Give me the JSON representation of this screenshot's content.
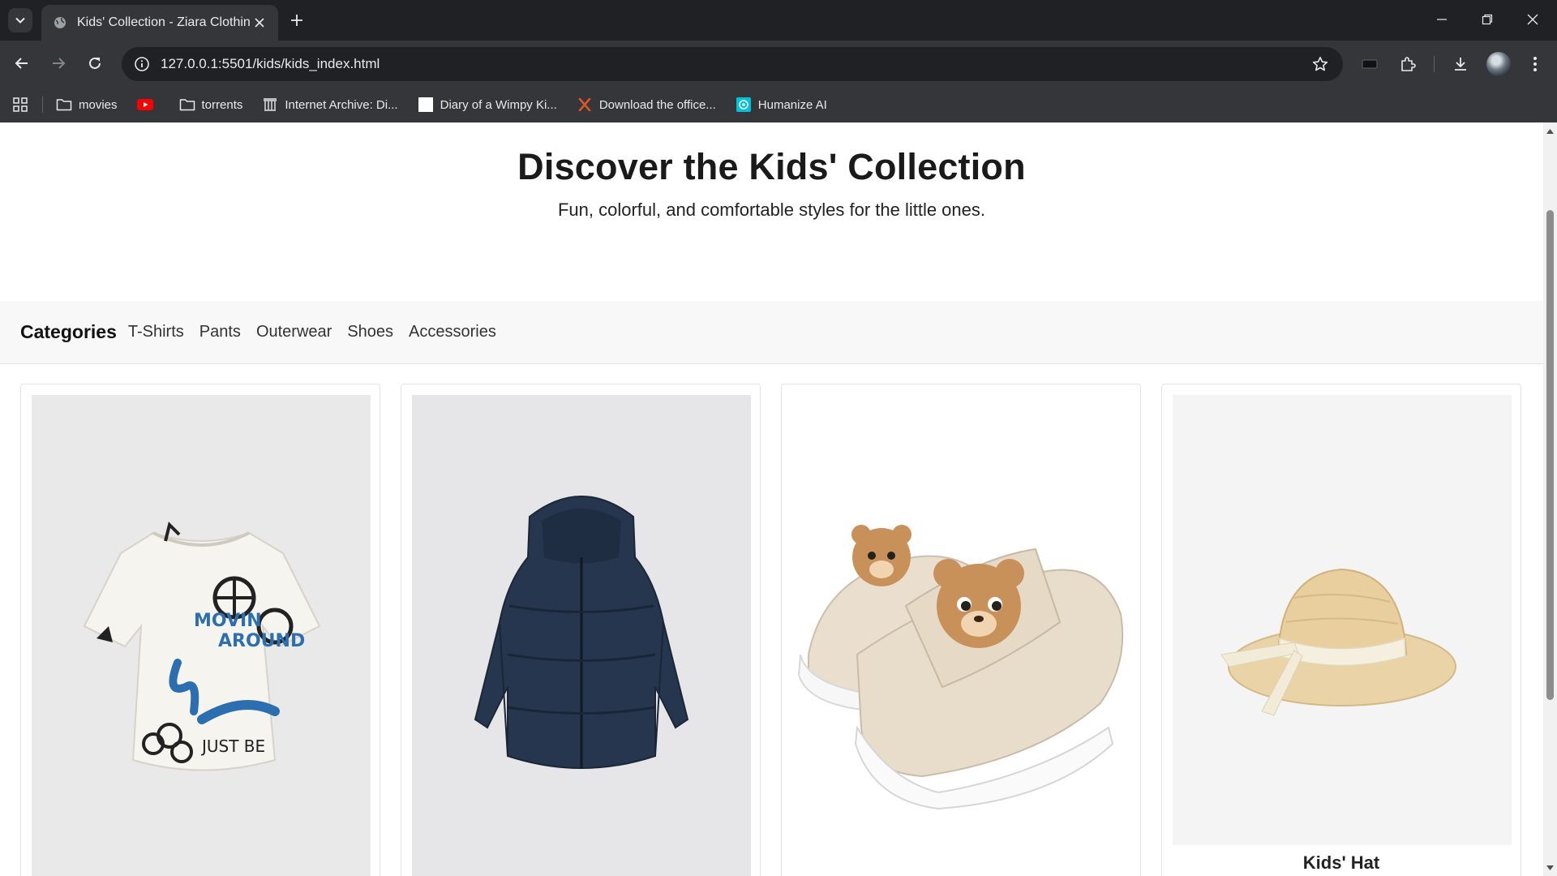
{
  "browser": {
    "tab_title": "Kids' Collection - Ziara Clothing",
    "url": "127.0.0.1:5501/kids/kids_index.html",
    "bookmarks": [
      {
        "label": "movies",
        "icon": "folder-icon"
      },
      {
        "label": "",
        "icon": "youtube-icon"
      },
      {
        "label": "torrents",
        "icon": "folder-icon"
      },
      {
        "label": "Internet Archive: Di...",
        "icon": "archive-icon"
      },
      {
        "label": "Diary of a Wimpy Ki...",
        "icon": "blank-page-icon"
      },
      {
        "label": "Download the office...",
        "icon": "x-logo-icon"
      },
      {
        "label": "Humanize AI",
        "icon": "humanize-icon"
      }
    ]
  },
  "hero": {
    "title": "Discover the Kids' Collection",
    "subtitle": "Fun, colorful, and comfortable styles for the little ones."
  },
  "categories": {
    "heading": "Categories",
    "links": [
      "T-Shirts",
      "Pants",
      "Outerwear",
      "Shoes",
      "Accessories"
    ]
  },
  "products": [
    {
      "name": "",
      "image": "graphic-tshirt",
      "image_bg": "#e9e9e9"
    },
    {
      "name": "",
      "image": "puffer-jacket",
      "image_bg": "#e6e6e8"
    },
    {
      "name": "",
      "image": "bear-sneakers",
      "image_bg": "#ffffff"
    },
    {
      "name": "Kids' Hat",
      "image": "straw-hat",
      "image_bg": "#f4f4f4"
    }
  ],
  "colors": {
    "chrome_dark": "#202124",
    "chrome": "#35363a",
    "jacket": "#26364e",
    "hat_straw": "#e9cf9d"
  }
}
